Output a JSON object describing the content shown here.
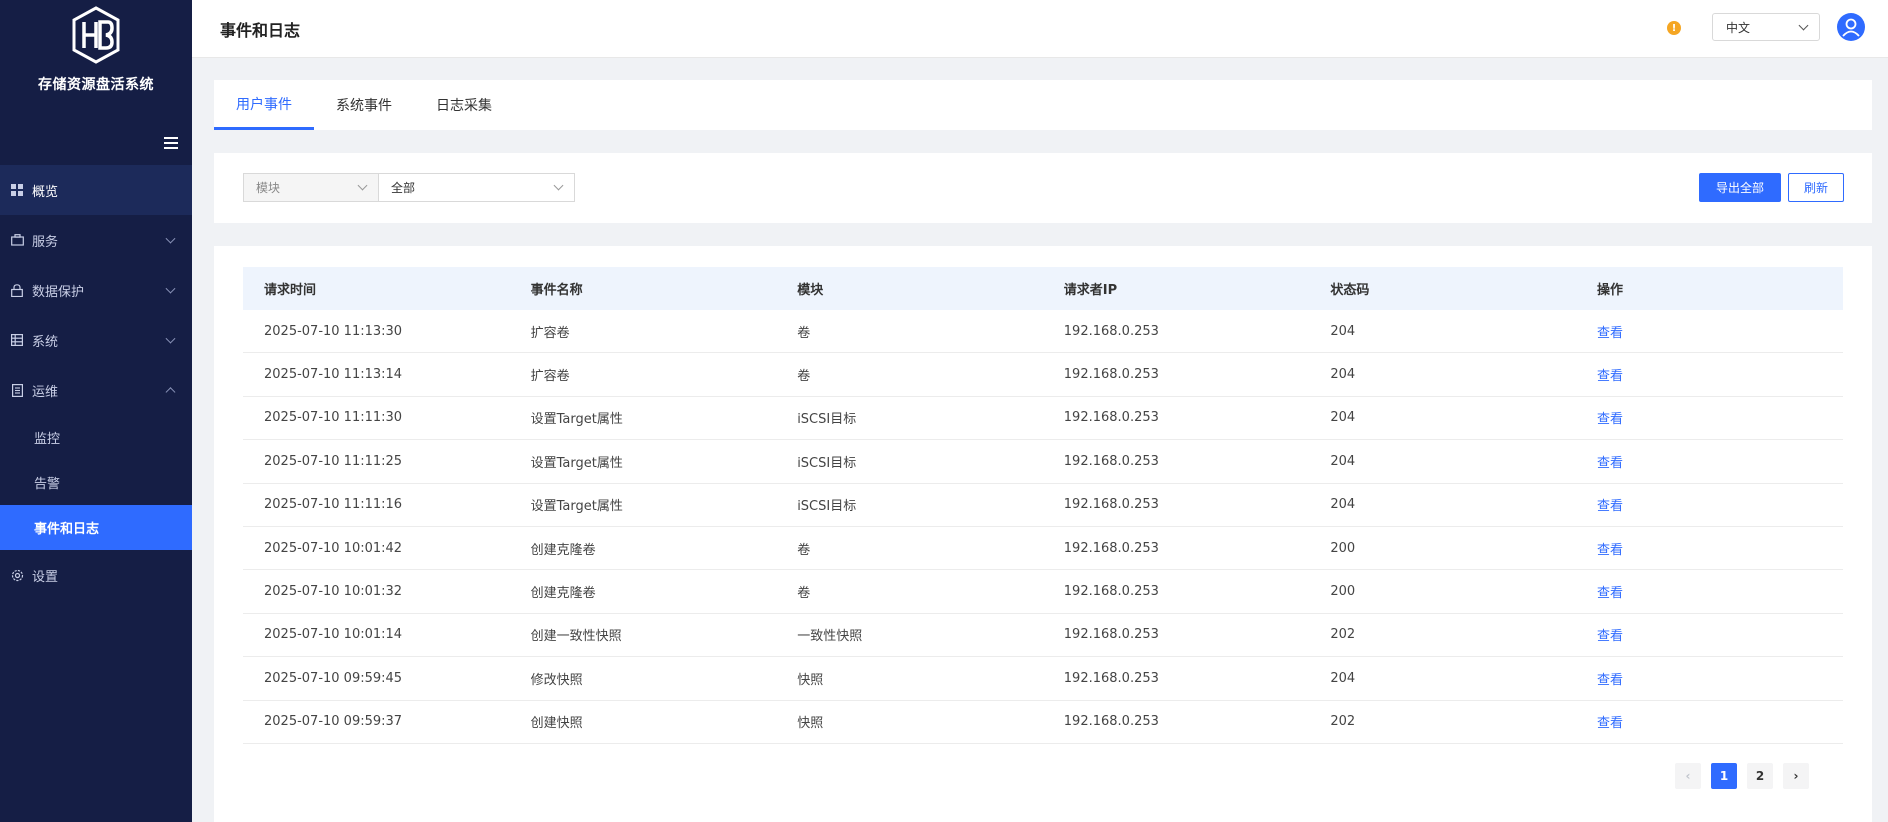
{
  "app": {
    "name": "存储资源盘活系统"
  },
  "sidebar": {
    "items": [
      {
        "label": "概览",
        "icon": "dashboard-icon"
      },
      {
        "label": "服务",
        "icon": "briefcase-icon"
      },
      {
        "label": "数据保护",
        "icon": "lock-icon"
      },
      {
        "label": "系统",
        "icon": "grid-icon"
      },
      {
        "label": "运维",
        "icon": "document-icon"
      },
      {
        "label": "设置",
        "icon": "gear-icon"
      }
    ],
    "ops_children": [
      {
        "label": "监控"
      },
      {
        "label": "告警"
      },
      {
        "label": "事件和日志"
      }
    ]
  },
  "header": {
    "title": "事件和日志",
    "alert_mark": "!",
    "language": "中文"
  },
  "tabs": [
    {
      "label": "用户事件"
    },
    {
      "label": "系统事件"
    },
    {
      "label": "日志采集"
    }
  ],
  "filters": {
    "module_placeholder": "模块",
    "value": "全部"
  },
  "actions": {
    "export_all": "导出全部",
    "refresh": "刷新"
  },
  "table": {
    "columns": [
      "请求时间",
      "事件名称",
      "模块",
      "请求者IP",
      "状态码",
      "操作"
    ],
    "rows": [
      {
        "time": "2025-07-10 11:13:30",
        "event": "扩容卷",
        "module": "卷",
        "ip": "192.168.0.253",
        "code": "204",
        "action": "查看"
      },
      {
        "time": "2025-07-10 11:13:14",
        "event": "扩容卷",
        "module": "卷",
        "ip": "192.168.0.253",
        "code": "204",
        "action": "查看"
      },
      {
        "time": "2025-07-10 11:11:30",
        "event": "设置Target属性",
        "module": "iSCSI目标",
        "ip": "192.168.0.253",
        "code": "204",
        "action": "查看"
      },
      {
        "time": "2025-07-10 11:11:25",
        "event": "设置Target属性",
        "module": "iSCSI目标",
        "ip": "192.168.0.253",
        "code": "204",
        "action": "查看"
      },
      {
        "time": "2025-07-10 11:11:16",
        "event": "设置Target属性",
        "module": "iSCSI目标",
        "ip": "192.168.0.253",
        "code": "204",
        "action": "查看"
      },
      {
        "time": "2025-07-10 10:01:42",
        "event": "创建克隆卷",
        "module": "卷",
        "ip": "192.168.0.253",
        "code": "200",
        "action": "查看"
      },
      {
        "time": "2025-07-10 10:01:32",
        "event": "创建克隆卷",
        "module": "卷",
        "ip": "192.168.0.253",
        "code": "200",
        "action": "查看"
      },
      {
        "time": "2025-07-10 10:01:14",
        "event": "创建一致性快照",
        "module": "一致性快照",
        "ip": "192.168.0.253",
        "code": "202",
        "action": "查看"
      },
      {
        "time": "2025-07-10 09:59:45",
        "event": "修改快照",
        "module": "快照",
        "ip": "192.168.0.253",
        "code": "204",
        "action": "查看"
      },
      {
        "time": "2025-07-10 09:59:37",
        "event": "创建快照",
        "module": "快照",
        "ip": "192.168.0.253",
        "code": "202",
        "action": "查看"
      }
    ]
  },
  "pagination": {
    "prev": "‹",
    "pages": [
      "1",
      "2"
    ],
    "next": "›"
  }
}
